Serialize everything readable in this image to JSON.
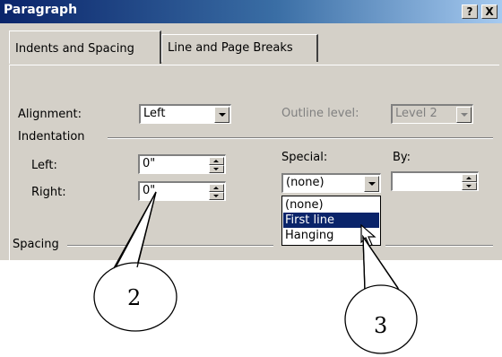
{
  "dialog": {
    "title": "Paragraph",
    "help_label": "?",
    "close_label": "X"
  },
  "tabs": [
    {
      "label": "Indents and Spacing",
      "access_key": "I",
      "active": true
    },
    {
      "label": "Line and Page Breaks",
      "access_key": "P",
      "active": false
    }
  ],
  "general": {
    "alignment_label": "Alignment:",
    "alignment_value": "Left",
    "outline_label": "Outline level:",
    "outline_value": "Level 2"
  },
  "indentation": {
    "group_label": "Indentation",
    "left_label": "Left:",
    "left_value": "0\"",
    "right_label": "Right:",
    "right_value": "0\"",
    "special_label": "Special:",
    "special_value": "(none)",
    "by_label": "By:",
    "by_value": "",
    "special_options": [
      "(none)",
      "First line",
      "Hanging"
    ],
    "special_highlighted": "First line"
  },
  "spacing": {
    "group_label": "Spacing"
  },
  "callouts": [
    {
      "number": "2"
    },
    {
      "number": "3"
    }
  ]
}
